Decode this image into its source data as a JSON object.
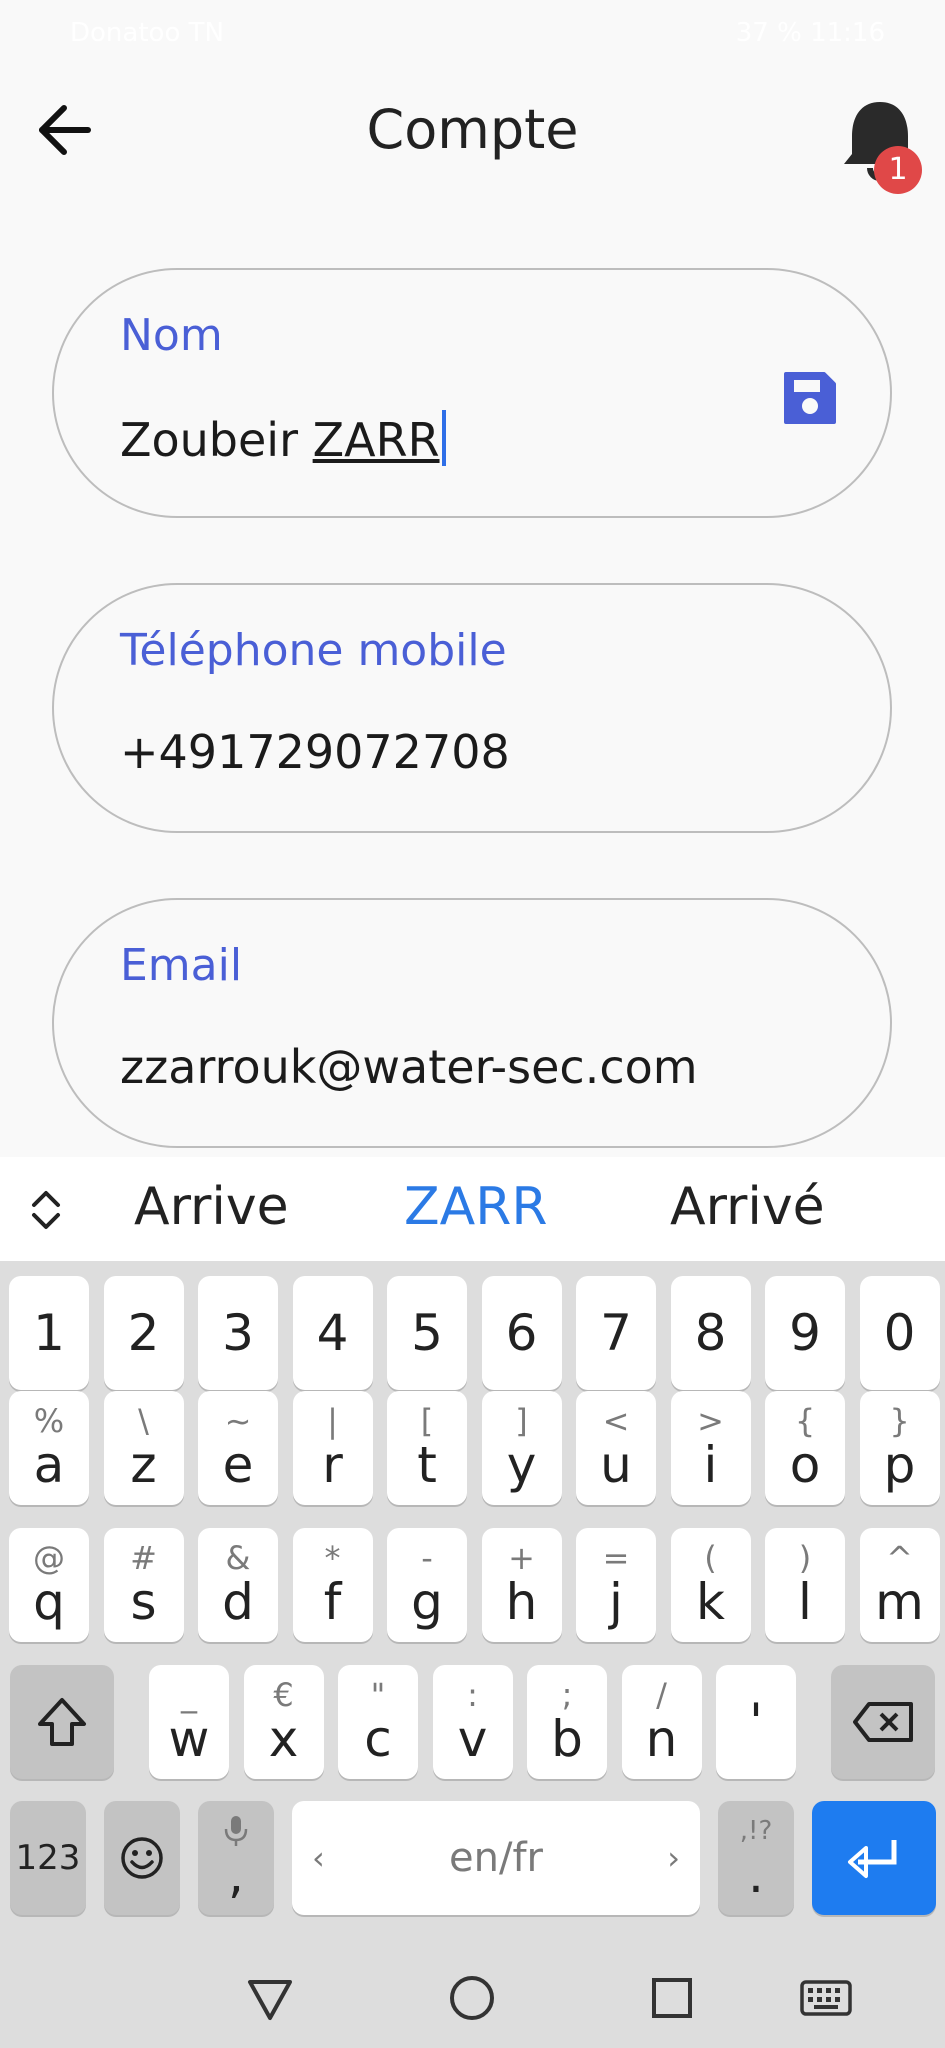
{
  "status": {
    "left": "Donatoo TN",
    "right": "37 % 11:16"
  },
  "header": {
    "title": "Compte",
    "back_icon": "arrow-left-icon",
    "notification_icon": "bell-icon",
    "badge_count": "1",
    "badge_color": "#e04848"
  },
  "fields": [
    {
      "label": "Nom",
      "value_plain": "Zoubeir ",
      "value_underlined": "ZARR",
      "focused": true
    },
    {
      "label": "Téléphone mobile",
      "value": "+491729072708"
    },
    {
      "label": "Email",
      "value": "zzarrouk@water-sec.com"
    }
  ],
  "colors": {
    "accent": "#4a5fd6",
    "save_icon": "#4a5fd6",
    "caret": "#2f6fe8",
    "keyboard_enter": "#1e7cf0"
  },
  "suggestions": [
    "Arrive",
    "ZARR",
    "Arrivé"
  ],
  "keyboard": {
    "row_numbers": [
      "1",
      "2",
      "3",
      "4",
      "5",
      "6",
      "7",
      "8",
      "9",
      "0"
    ],
    "row1": [
      {
        "k": "a",
        "s": "%"
      },
      {
        "k": "z",
        "s": "\\"
      },
      {
        "k": "e",
        "s": "~"
      },
      {
        "k": "r",
        "s": "|"
      },
      {
        "k": "t",
        "s": "["
      },
      {
        "k": "y",
        "s": "]"
      },
      {
        "k": "u",
        "s": "<"
      },
      {
        "k": "i",
        "s": ">"
      },
      {
        "k": "o",
        "s": "{"
      },
      {
        "k": "p",
        "s": "}"
      }
    ],
    "row2": [
      {
        "k": "q",
        "s": "@"
      },
      {
        "k": "s",
        "s": "#"
      },
      {
        "k": "d",
        "s": "&"
      },
      {
        "k": "f",
        "s": "*"
      },
      {
        "k": "g",
        "s": "-"
      },
      {
        "k": "h",
        "s": "+"
      },
      {
        "k": "j",
        "s": "="
      },
      {
        "k": "k",
        "s": "("
      },
      {
        "k": "l",
        "s": ")"
      },
      {
        "k": "m",
        "s": "^"
      }
    ],
    "row3": [
      {
        "k": "w",
        "s": "_"
      },
      {
        "k": "x",
        "s": "€"
      },
      {
        "k": "c",
        "s": "\""
      },
      {
        "k": "v",
        "s": ":"
      },
      {
        "k": "b",
        "s": ";"
      },
      {
        "k": "n",
        "s": "/"
      },
      {
        "k": "'",
        "s": ""
      }
    ],
    "key_123": "123",
    "comma": ",",
    "space_label": "en/fr",
    "period": ".",
    "period_sec": ",!?"
  }
}
